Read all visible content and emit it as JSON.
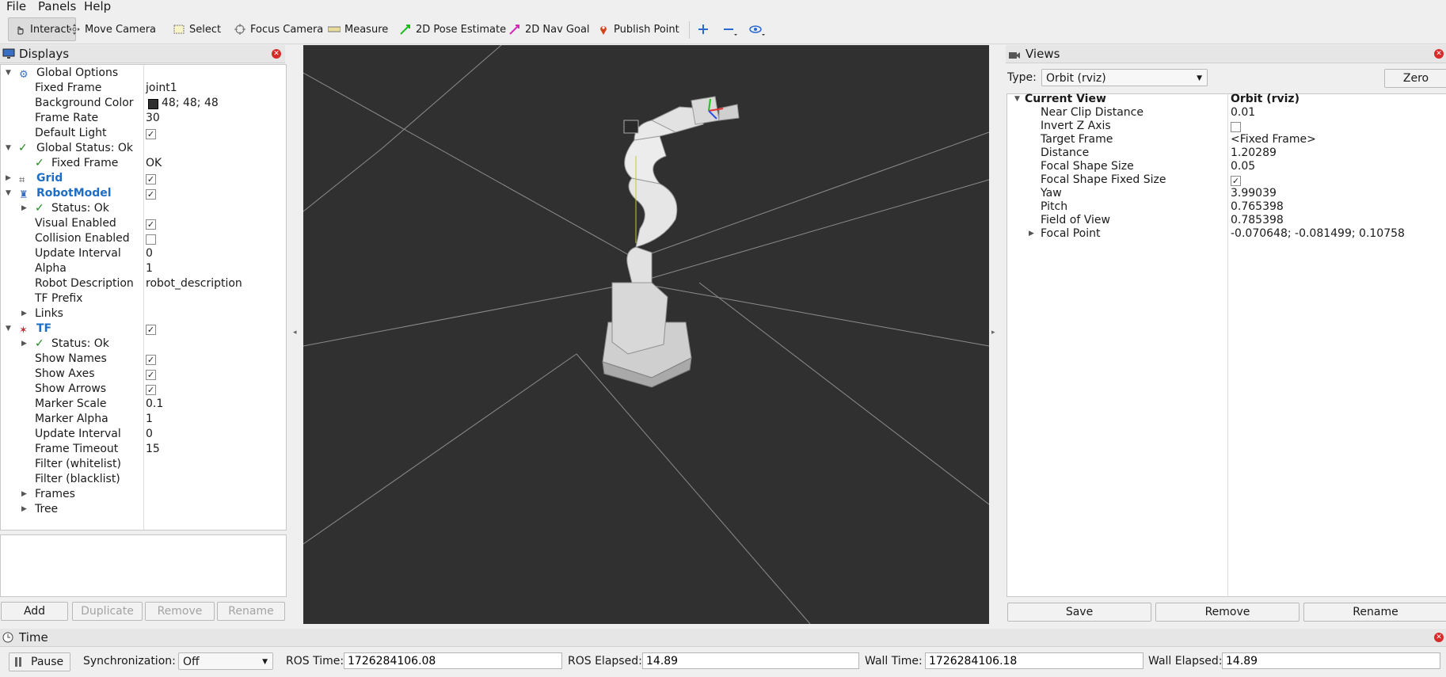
{
  "menu": [
    "File",
    "Panels",
    "Help"
  ],
  "toolbar": {
    "interact": "Interact",
    "move_camera": "Move Camera",
    "select": "Select",
    "focus_camera": "Focus Camera",
    "measure": "Measure",
    "pose_estimate": "2D Pose Estimate",
    "nav_goal": "2D Nav Goal",
    "publish_point": "Publish Point"
  },
  "displays": {
    "title": "Displays",
    "rows": [
      {
        "name": "Global Options",
        "value": ""
      },
      {
        "name": "Fixed Frame",
        "value": "joint1"
      },
      {
        "name": "Background Color",
        "value": "48; 48; 48"
      },
      {
        "name": "Frame Rate",
        "value": "30"
      },
      {
        "name": "Default Light",
        "value": ""
      },
      {
        "name": "Global Status: Ok",
        "value": ""
      },
      {
        "name": "Fixed Frame",
        "value": "OK"
      },
      {
        "name": "Grid",
        "value": ""
      },
      {
        "name": "RobotModel",
        "value": ""
      },
      {
        "name": "Status: Ok",
        "value": ""
      },
      {
        "name": "Visual Enabled",
        "value": ""
      },
      {
        "name": "Collision Enabled",
        "value": ""
      },
      {
        "name": "Update Interval",
        "value": "0"
      },
      {
        "name": "Alpha",
        "value": "1"
      },
      {
        "name": "Robot Description",
        "value": "robot_description"
      },
      {
        "name": "TF Prefix",
        "value": ""
      },
      {
        "name": "Links",
        "value": ""
      },
      {
        "name": "TF",
        "value": ""
      },
      {
        "name": "Status: Ok",
        "value": ""
      },
      {
        "name": "Show Names",
        "value": ""
      },
      {
        "name": "Show Axes",
        "value": ""
      },
      {
        "name": "Show Arrows",
        "value": ""
      },
      {
        "name": "Marker Scale",
        "value": "0.1"
      },
      {
        "name": "Marker Alpha",
        "value": "1"
      },
      {
        "name": "Update Interval",
        "value": "0"
      },
      {
        "name": "Frame Timeout",
        "value": "15"
      },
      {
        "name": "Filter (whitelist)",
        "value": ""
      },
      {
        "name": "Filter (blacklist)",
        "value": ""
      },
      {
        "name": "Frames",
        "value": ""
      },
      {
        "name": "Tree",
        "value": ""
      }
    ],
    "buttons": {
      "add": "Add",
      "duplicate": "Duplicate",
      "remove": "Remove",
      "rename": "Rename"
    }
  },
  "views": {
    "title": "Views",
    "type_label": "Type:",
    "type_value": "Orbit (rviz)",
    "zero": "Zero",
    "rows": [
      {
        "name": "Current View",
        "value": "Orbit (rviz)"
      },
      {
        "name": "Near Clip Distance",
        "value": "0.01"
      },
      {
        "name": "Invert Z Axis",
        "value": ""
      },
      {
        "name": "Target Frame",
        "value": "<Fixed Frame>"
      },
      {
        "name": "Distance",
        "value": "1.20289"
      },
      {
        "name": "Focal Shape Size",
        "value": "0.05"
      },
      {
        "name": "Focal Shape Fixed Size",
        "value": ""
      },
      {
        "name": "Yaw",
        "value": "3.99039"
      },
      {
        "name": "Pitch",
        "value": "0.765398"
      },
      {
        "name": "Field of View",
        "value": "0.785398"
      },
      {
        "name": "Focal Point",
        "value": "-0.070648; -0.081499; 0.10758"
      }
    ],
    "buttons": {
      "save": "Save",
      "remove": "Remove",
      "rename": "Rename"
    }
  },
  "time": {
    "title": "Time",
    "pause": "Pause",
    "sync_label": "Synchronization:",
    "sync_value": "Off",
    "ros_time_label": "ROS Time:",
    "ros_time": "1726284106.08",
    "ros_elapsed_label": "ROS Elapsed:",
    "ros_elapsed": "14.89",
    "wall_time_label": "Wall Time:",
    "wall_time": "1726284106.18",
    "wall_elapsed_label": "Wall Elapsed:",
    "wall_elapsed": "14.89"
  },
  "colors": {
    "viewport_bg": "#303030",
    "accent_blue": "#1e6ec8",
    "status_green": "#1a8a1a",
    "close_red": "#d72a2a"
  }
}
